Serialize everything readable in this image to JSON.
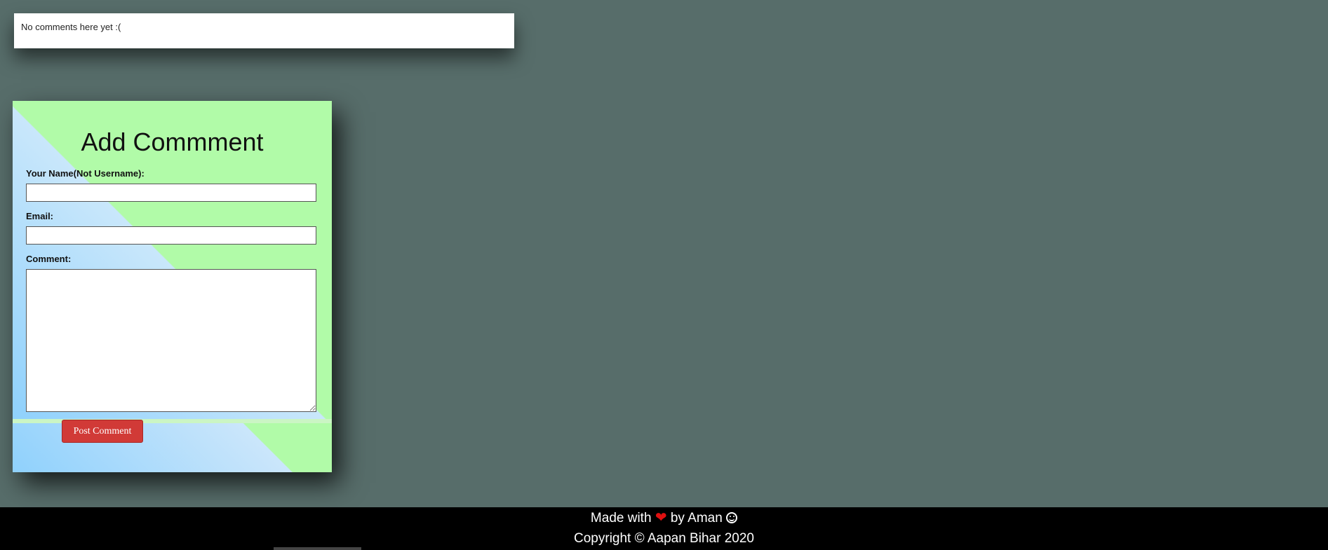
{
  "comments": {
    "empty_message": "No comments here yet :("
  },
  "form": {
    "title": "Add Commment",
    "name_label": "Your Name(Not Username):",
    "name_value": "",
    "email_label": "Email:",
    "email_value": "",
    "comment_label": "Comment:",
    "comment_value": "",
    "submit_label": "Post Comment"
  },
  "footer": {
    "made_with": "Made with",
    "heart_icon": "heart-icon",
    "by_text": "by Aman",
    "smile_icon": "smile-icon",
    "copyright": "Copyright © Aapan Bihar 2020"
  },
  "colors": {
    "page_background": "#576d6a",
    "button": "#d13a37",
    "gradient_blue": "#8fd1fc",
    "gradient_green": "#b1fba8",
    "footer_background": "#000000"
  }
}
